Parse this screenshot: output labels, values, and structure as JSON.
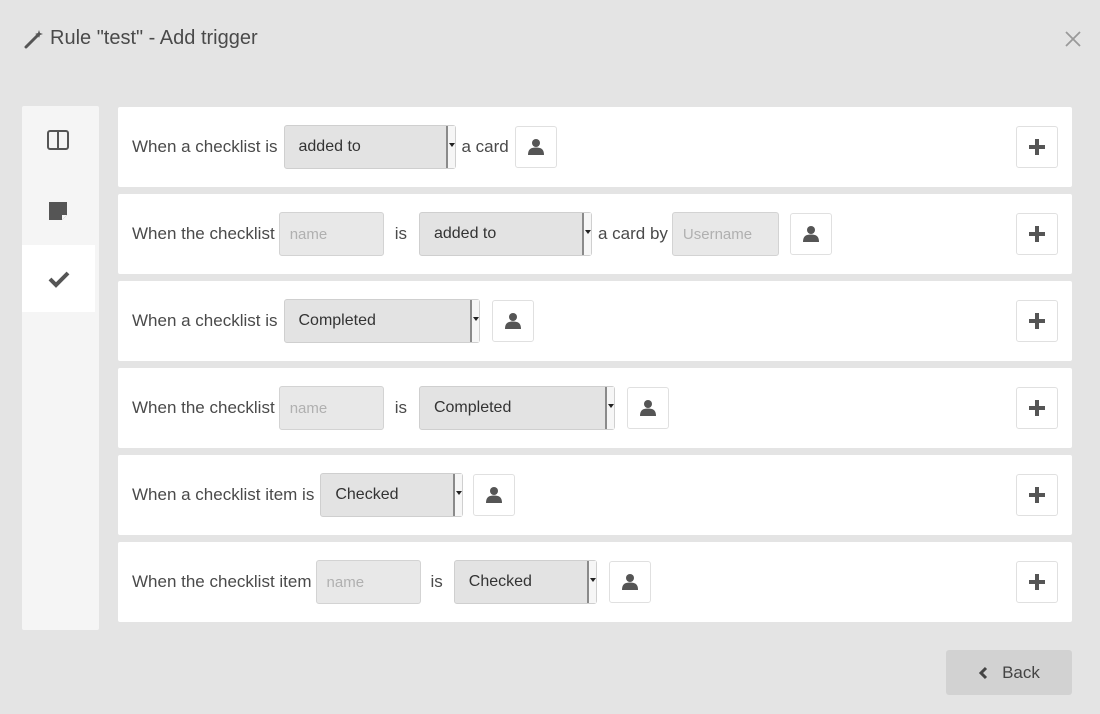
{
  "dialog": {
    "title": "Rule \"test\" - Add trigger",
    "back_label": "Back"
  },
  "sidebar": {
    "tabs": [
      {
        "icon": "columns-icon",
        "active": false
      },
      {
        "icon": "sticky-note-icon",
        "active": false
      },
      {
        "icon": "check-icon",
        "active": true
      }
    ]
  },
  "triggers": [
    {
      "pre": "When a checklist is",
      "select": "added to",
      "post": "a card"
    },
    {
      "pre": "When the checklist",
      "name_placeholder": "name",
      "is": "is",
      "select": "added to",
      "post": "a card by",
      "user_placeholder": "Username"
    },
    {
      "pre": "When a checklist is",
      "select": "Completed"
    },
    {
      "pre": "When the checklist",
      "name_placeholder": "name",
      "is": "is",
      "select": "Completed"
    },
    {
      "pre": "When a checklist item is",
      "select": "Checked"
    },
    {
      "pre": "When the checklist item",
      "name_placeholder": "name",
      "is": "is",
      "select": "Checked"
    }
  ],
  "colors": {
    "background": "#e4e4e4",
    "card": "#ffffff",
    "icon": "#555555"
  }
}
